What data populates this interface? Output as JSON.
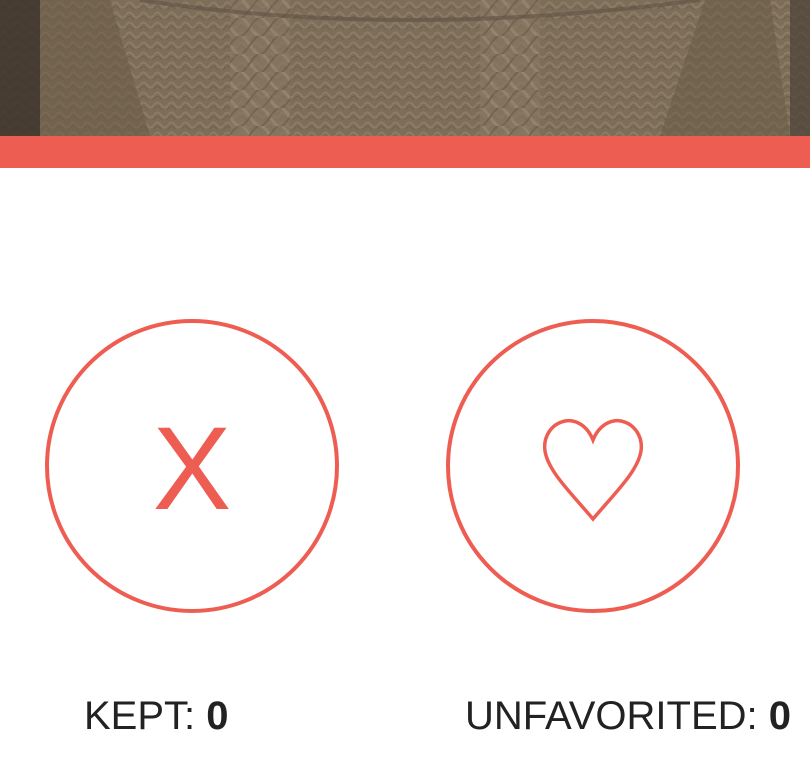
{
  "photo": {
    "description_icon": "sweater-photo"
  },
  "colors": {
    "accent": "#ee5d52",
    "text": "#222222",
    "background": "#ffffff"
  },
  "actions": {
    "reject_glyph": "X",
    "reject_icon": "x-icon",
    "favorite_icon": "heart-icon"
  },
  "counters": {
    "kept_label": "KEPT: ",
    "kept_value": "0",
    "unfavorited_label": "UNFAVORITED: ",
    "unfavorited_value": "0"
  }
}
